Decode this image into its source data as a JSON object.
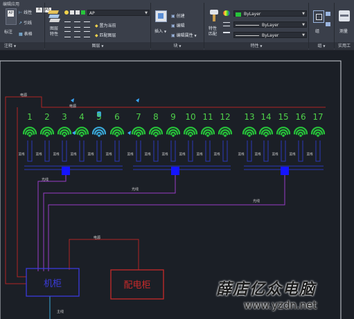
{
  "title_strip": "编辑应用",
  "ribbon": {
    "annotate": {
      "big_icon_label": "标注",
      "items": [
        "线性",
        "引线",
        "表格"
      ],
      "group_label": "注释"
    },
    "layers": {
      "big_icon_label": "图层\n特性",
      "current_layer": "AP",
      "buttons": [
        "置为当前",
        "匹配图层"
      ],
      "group_label": "图层"
    },
    "block": {
      "big_icon_label": "插入",
      "items": [
        "创建",
        "编辑",
        "编辑属性"
      ],
      "group_label": "块"
    },
    "properties": {
      "match_label": "特性\n匹配",
      "color_value": "ByLayer",
      "linetype_value": "ByLayer",
      "lineweight_value": "ByLayer",
      "group_label": "特性"
    },
    "groups": {
      "big_icon_label": "组",
      "group_label": "组"
    },
    "utilities": {
      "big_icon_label": "测量",
      "group_label": "实用工"
    }
  },
  "drawing": {
    "ap_numbers": [
      "1",
      "2",
      "3",
      "4",
      "5",
      "6",
      "7",
      "8",
      "9",
      "10",
      "11",
      "12",
      "13",
      "14",
      "15",
      "16",
      "17"
    ],
    "cable_label_power": "电源",
    "cable_label_fiber": "光线",
    "cable_label_network": "蓝线",
    "cable_label_main": "主线",
    "cabinet_label": "机柜",
    "dist_cabinet_label": "配电柜",
    "watermark_cn": "薛店亿众电脑",
    "watermark_url": "www.yzdn.net"
  },
  "colors": {
    "wifi": "#27c43a",
    "numbers": "#4fd14a",
    "switch": "#1414ff",
    "blue_line": "#2b3ab8",
    "purple_line": "#9a3cc8",
    "red_line": "#b02424",
    "cabinet": "#3b3bdc",
    "dist_cabinet": "#c82a2a"
  }
}
